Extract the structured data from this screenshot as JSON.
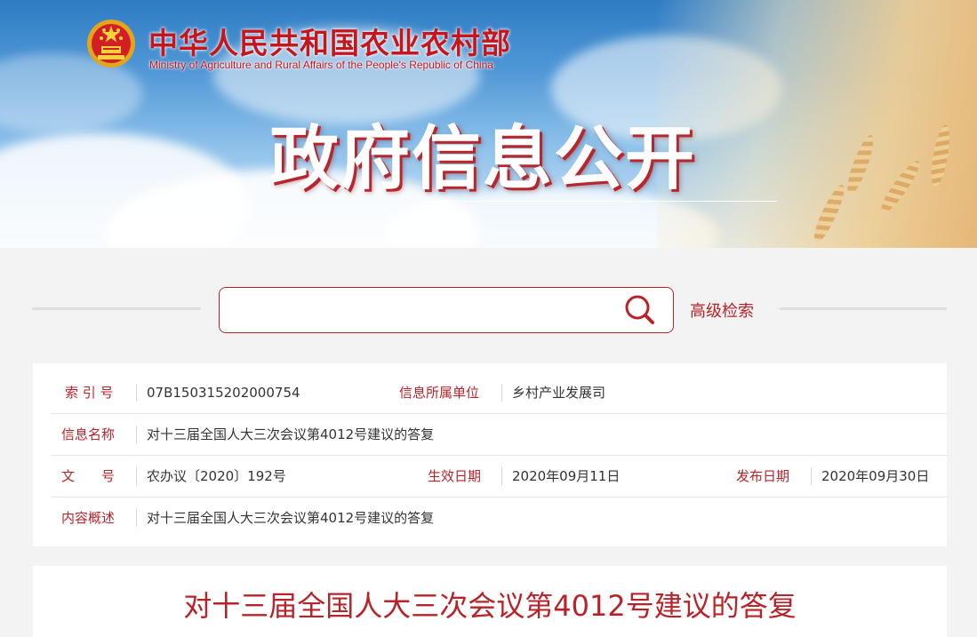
{
  "header": {
    "ministry_name_cn": "中华人民共和国农业农村部",
    "ministry_name_en": "Ministry of Agriculture and Rural Affairs of the People's Republic of China",
    "section_title": "政府信息公开",
    "brand_color": "#c4161c"
  },
  "search": {
    "placeholder": "",
    "value": "",
    "advanced_label": "高级检索",
    "icon": "search-icon"
  },
  "info": {
    "index_label": "索 引 号",
    "index_value": "07B150315202000754",
    "unit_label": "信息所属单位",
    "unit_value": "乡村产业发展司",
    "name_label": "信息名称",
    "name_value": "对十三届全国人大三次会议第4012号建议的答复",
    "doc_label": "文　　号",
    "doc_value": "农办议〔2020〕192号",
    "effective_label": "生效日期",
    "effective_value": "2020年09月11日",
    "publish_label": "发布日期",
    "publish_value": "2020年09月30日",
    "summary_label": "内容概述",
    "summary_value": "对十三届全国人大三次会议第4012号建议的答复"
  },
  "article": {
    "title": "对十三届全国人大三次会议第4012号建议的答复"
  },
  "colors": {
    "accent": "#b8232a",
    "background": "#f3f3f3"
  }
}
